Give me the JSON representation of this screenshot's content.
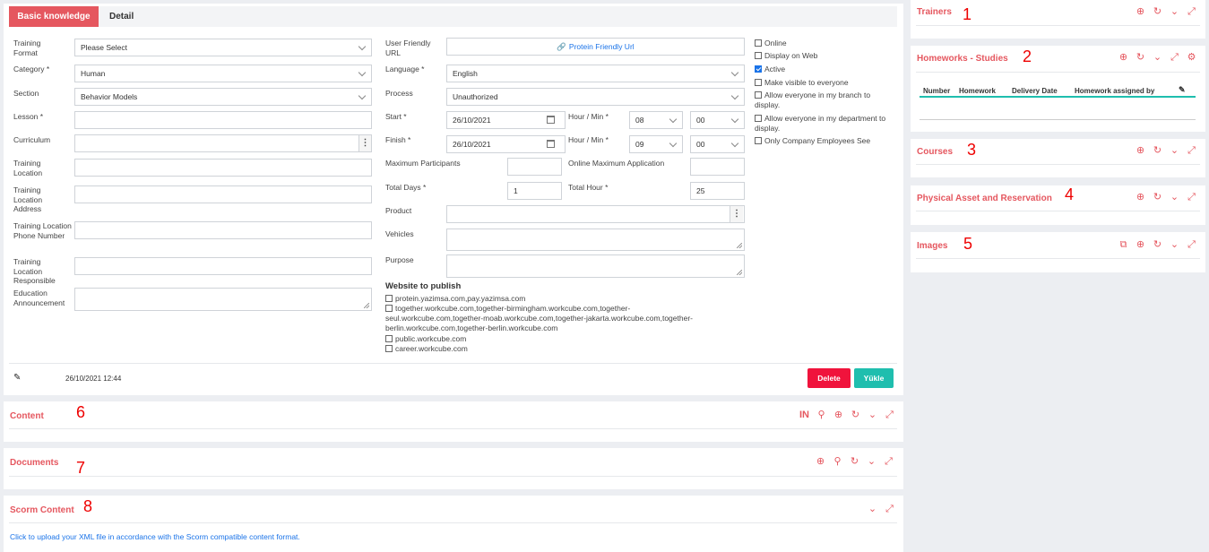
{
  "tabs": {
    "basic": "Basic knowledge",
    "detail": "Detail"
  },
  "left": {
    "training_format": {
      "label": "Training Format",
      "value": "Please Select"
    },
    "category": {
      "label": "Category *",
      "value": "Human"
    },
    "section": {
      "label": "Section",
      "value": "Behavior Models"
    },
    "lesson": {
      "label": "Lesson *"
    },
    "curriculum": {
      "label": "Curriculum"
    },
    "training_location": {
      "label": "Training Location"
    },
    "training_location_address": {
      "label": "Training Location Address"
    },
    "training_location_phone": {
      "label": "Training Location Phone Number"
    },
    "training_location_responsible": {
      "label": "Training Location Responsible"
    },
    "education_announcement": {
      "label": "Education Announcement"
    }
  },
  "mid": {
    "user_friendly_url": {
      "label": "User Friendly URL",
      "value": "Protein Friendly Url"
    },
    "language": {
      "label": "Language *",
      "value": "English"
    },
    "process": {
      "label": "Process",
      "value": "Unauthorized"
    },
    "start": {
      "label": "Start *",
      "date": "26/10/2021",
      "hm_label": "Hour / Min *",
      "hour": "08",
      "min": "00"
    },
    "finish": {
      "label": "Finish *",
      "date": "26/10/2021",
      "hm_label": "Hour / Min *",
      "hour": "09",
      "min": "00"
    },
    "max_participants": {
      "label": "Maximum Participants",
      "value": ""
    },
    "online_max_app": {
      "label": "Online Maximum Application",
      "value": ""
    },
    "total_days": {
      "label": "Total Days *",
      "value": "1"
    },
    "total_hour": {
      "label": "Total Hour *",
      "value": "25"
    },
    "product": {
      "label": "Product"
    },
    "vehicles": {
      "label": "Vehicles"
    },
    "purpose": {
      "label": "Purpose"
    },
    "website_title": "Website to publish",
    "websites": [
      "protein.yazimsa.com,pay.yazimsa.com",
      "together.workcube.com,together-birmingham.workcube.com,together-",
      "seul.workcube.com,together-moab.workcube.com,together-jakarta.workcube.com,together-",
      "berlin.workcube.com,together-berlin.workcube.com",
      "public.workcube.com",
      "career.workcube.com"
    ]
  },
  "right_checks": [
    {
      "label": "Online",
      "checked": false
    },
    {
      "label": "Display on Web",
      "checked": false
    },
    {
      "label": "Active",
      "checked": true
    },
    {
      "label": "Make visible to everyone",
      "checked": false
    },
    {
      "label": "Allow everyone in my branch to",
      "label2": "display.",
      "checked": false
    },
    {
      "label": "Allow everyone in my department to",
      "label2": "display.",
      "checked": false
    },
    {
      "label": "Only Company Employees See",
      "checked": false
    }
  ],
  "footer": {
    "timestamp": "26/10/2021 12:44",
    "delete": "Delete",
    "upload": "Yükle"
  },
  "panels": {
    "content": {
      "title": "Content",
      "num": "6",
      "in": "IN"
    },
    "documents": {
      "title": "Documents",
      "num": "7"
    },
    "scorm": {
      "title": "Scorm Content",
      "num": "8",
      "text": "Click to upload your XML file in accordance with the Scorm compatible content format."
    },
    "trainers": {
      "title": "Trainers",
      "num": "1"
    },
    "homeworks": {
      "title": "Homeworks - Studies",
      "num": "2",
      "cols": [
        "Number",
        "Homework",
        "Delivery Date",
        "Homework assigned by"
      ]
    },
    "courses": {
      "title": "Courses",
      "num": "3"
    },
    "physical": {
      "title": "Physical Asset and Reservation",
      "num": "4"
    },
    "images": {
      "title": "Images",
      "num": "5"
    }
  },
  "colors": {
    "accent": "#e5575f",
    "delete": "#f0133c",
    "upload": "#1fbeae",
    "link": "#1a73e8"
  }
}
